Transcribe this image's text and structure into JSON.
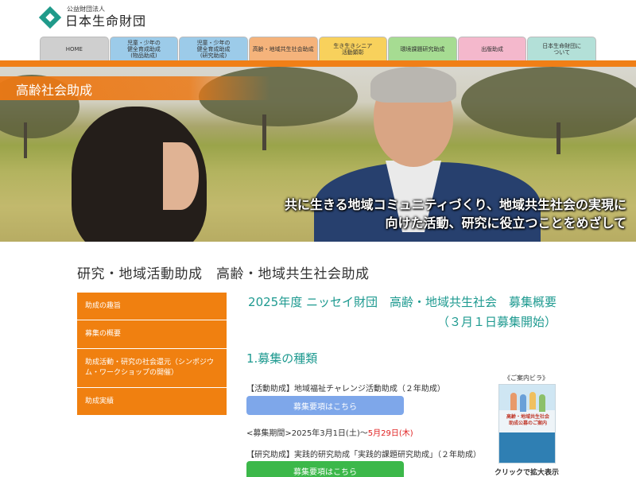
{
  "header": {
    "logo_sub": "公益財団法人",
    "logo_main": "日本生命財団"
  },
  "nav": {
    "tabs": [
      {
        "label": "HOME",
        "color": "#cfcfcf"
      },
      {
        "label": "児童・少年の\n健全育成助成\n(物品助成)",
        "color": "#9ccbe9"
      },
      {
        "label": "児童・少年の\n健全育成助成\n(研究助成)",
        "color": "#9ccbe9"
      },
      {
        "label": "高齢・地域共生社会助成",
        "color": "#f5b37b"
      },
      {
        "label": "生き生きシニア\n活動顕彰",
        "color": "#f8d15c"
      },
      {
        "label": "環境課題研究助成",
        "color": "#a6dc92"
      },
      {
        "label": "出版助成",
        "color": "#f4b8cc"
      },
      {
        "label": "日本生命財団に\nついて",
        "color": "#b3e0d8"
      }
    ],
    "accent_color": "#f07f17"
  },
  "hero": {
    "title": "高齢社会助成",
    "caption_line1": "共に生きる地域コミュニティづくり、地域共生社会の実現に",
    "caption_line2": "向けた活動、研究に役立つことをめざして"
  },
  "main": {
    "page_title": "研究・地域活動助成　高齢・地域共生社会助成",
    "sidebar": [
      {
        "label": "助成の趣旨"
      },
      {
        "label": "募集の概要"
      },
      {
        "label": "助成活動・研究の社会還元（シンポジウム・ワークショップの開催）"
      },
      {
        "label": "助成実績"
      }
    ],
    "heading_line1": "2025年度 ニッセイ財団　高齢・地域共生社会　募集概要",
    "heading_line2": "（３月１日募集開始）",
    "section_title": "1.募集の種類",
    "item1_label": "【活動助成】地域福祉チャレンジ活動助成（２年助成）",
    "item1_button": "募集要項はこちら",
    "period_prefix": "<募集期間>2025年3月1日(土)〜",
    "period_end": "5月29日(木)",
    "item2_label": "【研究助成】実践的研究助成「実践的課題研究助成」（２年助成）",
    "item2_button": "募集要項はこちら",
    "flyer_label": "《ご案内ビラ》",
    "flyer_text": "高齢・地域共生社会\n助成公募のご案内",
    "flyer_caption": "クリックで拡大表示"
  }
}
